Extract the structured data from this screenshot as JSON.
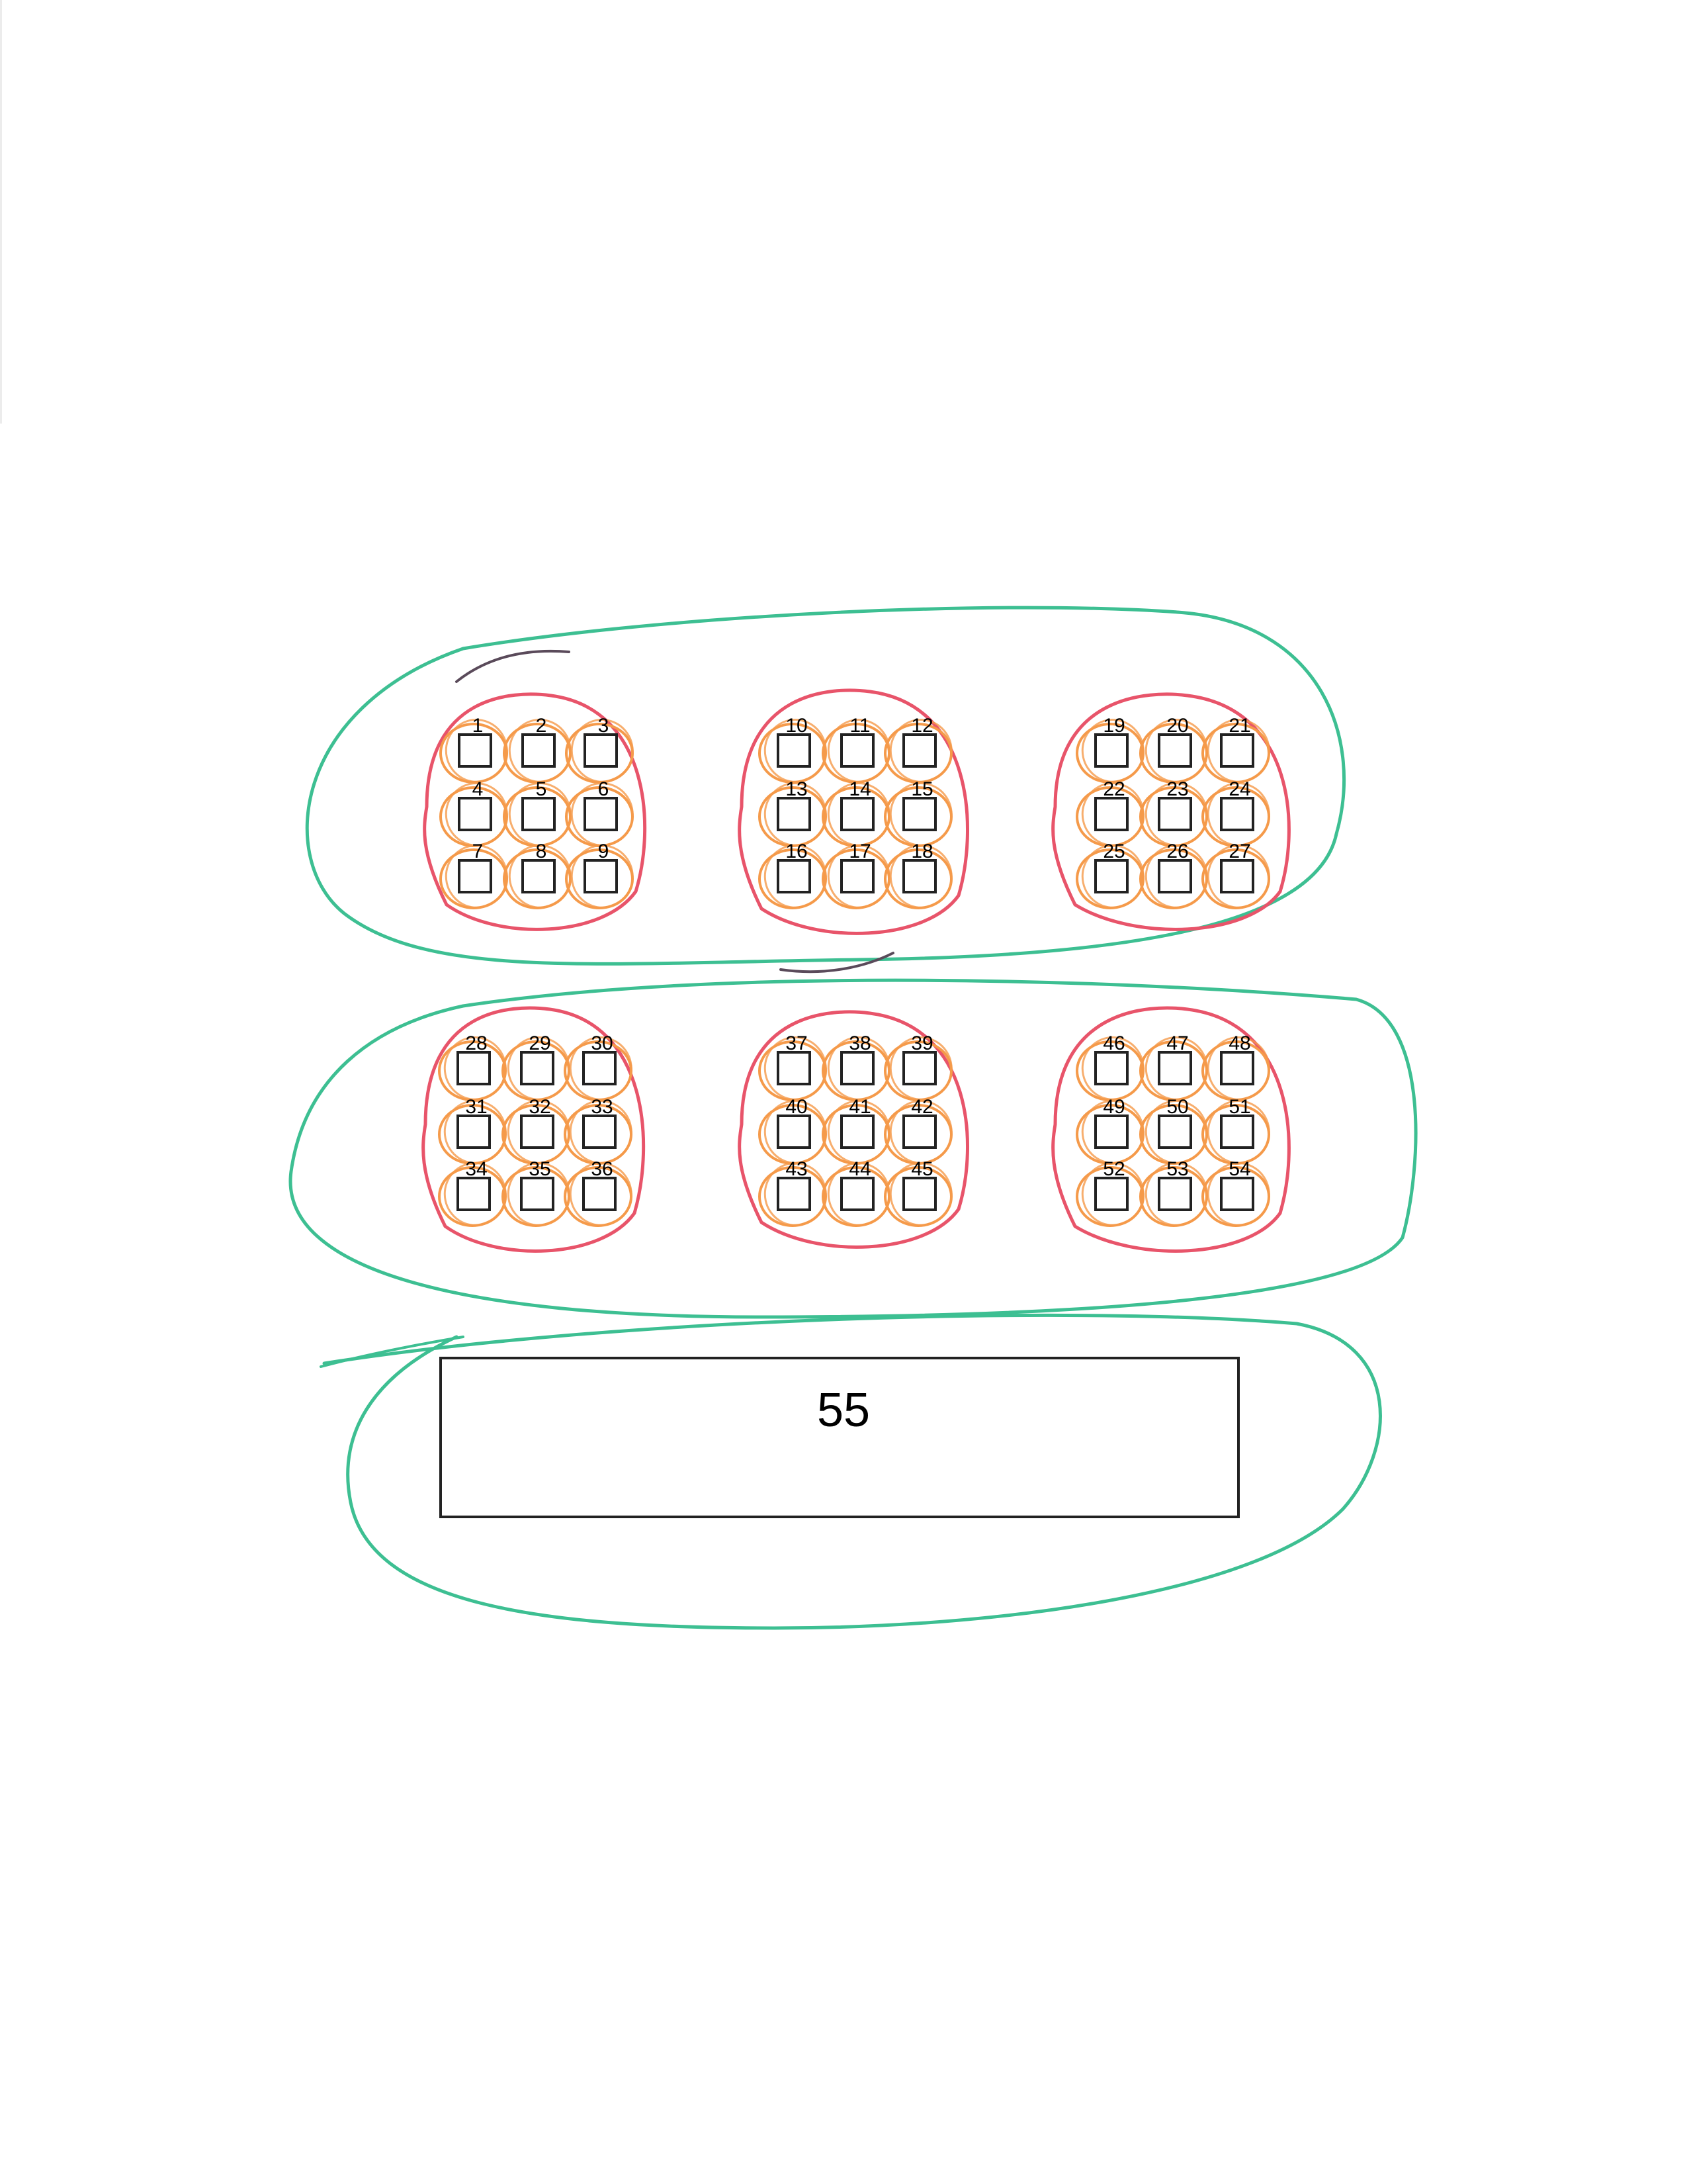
{
  "colors": {
    "background": "#ffffff",
    "box_stroke": "#222222",
    "item_loop": "#f59a4a",
    "group_loop": "#e8546a",
    "row_loop": "#3dbf92",
    "pen_mark": "#5a4a5a"
  },
  "groups": [
    {
      "labels": [
        "1",
        "2",
        "3",
        "4",
        "5",
        "6",
        "7",
        "8",
        "9"
      ]
    },
    {
      "labels": [
        "10",
        "11",
        "12",
        "13",
        "14",
        "15",
        "16",
        "17",
        "18"
      ]
    },
    {
      "labels": [
        "19",
        "20",
        "21",
        "22",
        "23",
        "24",
        "25",
        "26",
        "27"
      ]
    },
    {
      "labels": [
        "28",
        "29",
        "30",
        "31",
        "32",
        "33",
        "34",
        "35",
        "36"
      ]
    },
    {
      "labels": [
        "37",
        "38",
        "39",
        "40",
        "41",
        "42",
        "43",
        "44",
        "45"
      ]
    },
    {
      "labels": [
        "46",
        "47",
        "48",
        "49",
        "50",
        "51",
        "52",
        "53",
        "54"
      ]
    }
  ],
  "big_box": {
    "label": "55"
  }
}
